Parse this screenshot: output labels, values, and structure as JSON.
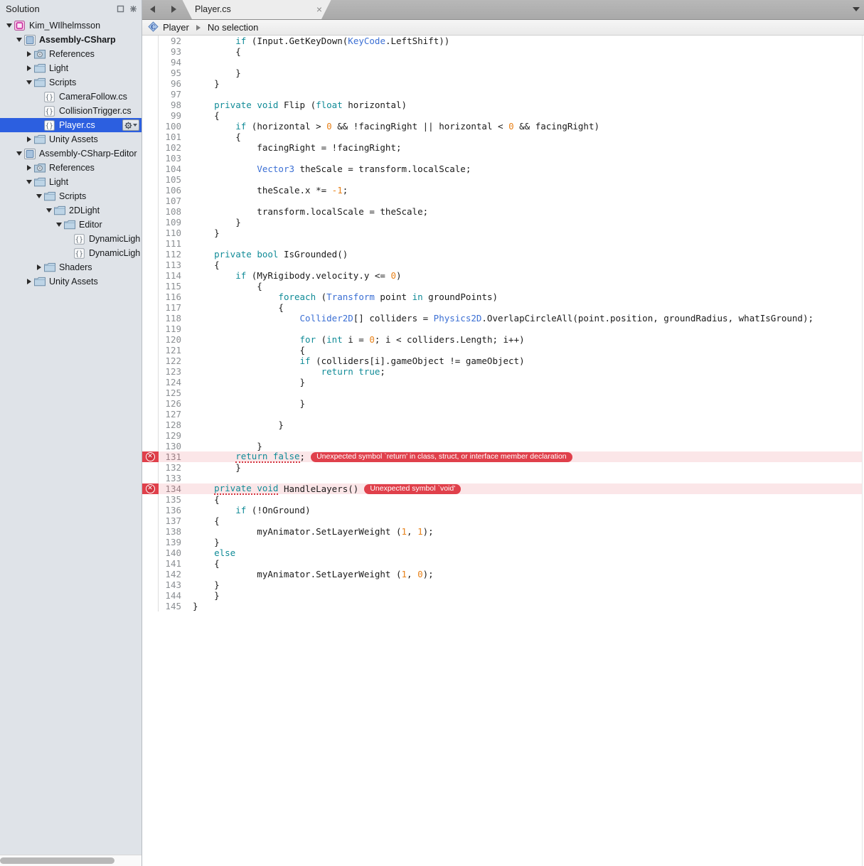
{
  "sidebar": {
    "title": "Solution",
    "window_buttons": [
      {
        "name": "maximize-icon",
        "glyph": "square"
      },
      {
        "name": "close-icon",
        "glyph": "cross"
      }
    ],
    "tree": [
      {
        "label": "Kim_WIlhelmsson",
        "indent": 0,
        "twisty": "open",
        "icon": "solution-icon",
        "bold": false,
        "selected": false
      },
      {
        "label": "Assembly-CSharp",
        "indent": 1,
        "twisty": "open",
        "icon": "project-icon",
        "bold": true,
        "selected": false
      },
      {
        "label": "References",
        "indent": 2,
        "twisty": "closed",
        "icon": "references-icon",
        "bold": false,
        "selected": false
      },
      {
        "label": "Light",
        "indent": 2,
        "twisty": "closed",
        "icon": "folder-icon",
        "bold": false,
        "selected": false
      },
      {
        "label": "Scripts",
        "indent": 2,
        "twisty": "open",
        "icon": "folder-icon",
        "bold": false,
        "selected": false
      },
      {
        "label": "CameraFollow.cs",
        "indent": 3,
        "twisty": "none",
        "icon": "csharp-file-icon",
        "bold": false,
        "selected": false
      },
      {
        "label": "CollisionTrigger.cs",
        "indent": 3,
        "twisty": "none",
        "icon": "csharp-file-icon",
        "bold": false,
        "selected": false
      },
      {
        "label": "Player.cs",
        "indent": 3,
        "twisty": "none",
        "icon": "csharp-file-icon",
        "bold": false,
        "selected": true
      },
      {
        "label": "Unity Assets",
        "indent": 2,
        "twisty": "closed",
        "icon": "folder-icon",
        "bold": false,
        "selected": false
      },
      {
        "label": "Assembly-CSharp-Editor",
        "indent": 1,
        "twisty": "open",
        "icon": "project-icon",
        "bold": false,
        "selected": false
      },
      {
        "label": "References",
        "indent": 2,
        "twisty": "closed",
        "icon": "references-icon",
        "bold": false,
        "selected": false
      },
      {
        "label": "Light",
        "indent": 2,
        "twisty": "open",
        "icon": "folder-icon",
        "bold": false,
        "selected": false
      },
      {
        "label": "Scripts",
        "indent": 3,
        "twisty": "open",
        "icon": "folder-icon",
        "bold": false,
        "selected": false
      },
      {
        "label": "2DLight",
        "indent": 4,
        "twisty": "open",
        "icon": "folder-icon",
        "bold": false,
        "selected": false
      },
      {
        "label": "Editor",
        "indent": 5,
        "twisty": "open",
        "icon": "folder-icon",
        "bold": false,
        "selected": false
      },
      {
        "label": "DynamicLightEditor.c",
        "indent": 6,
        "twisty": "none",
        "icon": "csharp-file-icon",
        "bold": false,
        "selected": false
      },
      {
        "label": "DynamicLightMenu.c",
        "indent": 6,
        "twisty": "none",
        "icon": "csharp-file-icon",
        "bold": false,
        "selected": false
      },
      {
        "label": "Shaders",
        "indent": 3,
        "twisty": "closed",
        "icon": "folder-icon",
        "bold": false,
        "selected": false
      },
      {
        "label": "Unity Assets",
        "indent": 2,
        "twisty": "closed",
        "icon": "folder-icon",
        "bold": false,
        "selected": false
      }
    ],
    "selected_row_gear": "gear-dropdown-button"
  },
  "tabstrip": {
    "back_label": "back-arrow",
    "forward_label": "forward-arrow",
    "tabs": [
      {
        "label": "Player.cs",
        "close": "×",
        "active": true
      }
    ],
    "overflow_menu": "tab-list-dropdown"
  },
  "breadcrumb": {
    "class_icon": "class-icon",
    "class_name": "Player",
    "member": "No selection"
  },
  "editor": {
    "first_line": 92,
    "error_icon_glyph": "✕",
    "lines": [
      {
        "n": 92,
        "error": false,
        "tokens": [
          {
            "t": "        ",
            "c": "pln"
          },
          {
            "t": "if",
            "c": "kw"
          },
          {
            "t": " (",
            "c": "pln"
          },
          {
            "t": "Input",
            "c": "pln"
          },
          {
            "t": ".GetKeyDown(",
            "c": "pln"
          },
          {
            "t": "KeyCode",
            "c": "typ"
          },
          {
            "t": ".LeftShift))",
            "c": "pln"
          }
        ]
      },
      {
        "n": 93,
        "error": false,
        "tokens": [
          {
            "t": "        {",
            "c": "pln"
          }
        ]
      },
      {
        "n": 94,
        "error": false,
        "tokens": []
      },
      {
        "n": 95,
        "error": false,
        "tokens": [
          {
            "t": "        }",
            "c": "pln"
          }
        ]
      },
      {
        "n": 96,
        "error": false,
        "tokens": [
          {
            "t": "    }",
            "c": "pln"
          }
        ]
      },
      {
        "n": 97,
        "error": false,
        "tokens": []
      },
      {
        "n": 98,
        "error": false,
        "tokens": [
          {
            "t": "    ",
            "c": "pln"
          },
          {
            "t": "private void",
            "c": "kw"
          },
          {
            "t": " Flip (",
            "c": "pln"
          },
          {
            "t": "float",
            "c": "kw"
          },
          {
            "t": " horizontal)",
            "c": "pln"
          }
        ]
      },
      {
        "n": 99,
        "error": false,
        "tokens": [
          {
            "t": "    {",
            "c": "pln"
          }
        ]
      },
      {
        "n": 100,
        "error": false,
        "tokens": [
          {
            "t": "        ",
            "c": "pln"
          },
          {
            "t": "if",
            "c": "kw"
          },
          {
            "t": " (horizontal > ",
            "c": "pln"
          },
          {
            "t": "0",
            "c": "num"
          },
          {
            "t": " && !facingRight || horizontal < ",
            "c": "pln"
          },
          {
            "t": "0",
            "c": "num"
          },
          {
            "t": " && facingRight)",
            "c": "pln"
          }
        ]
      },
      {
        "n": 101,
        "error": false,
        "tokens": [
          {
            "t": "        {",
            "c": "pln"
          }
        ]
      },
      {
        "n": 102,
        "error": false,
        "tokens": [
          {
            "t": "            facingRight = !facingRight;",
            "c": "pln"
          }
        ]
      },
      {
        "n": 103,
        "error": false,
        "tokens": []
      },
      {
        "n": 104,
        "error": false,
        "tokens": [
          {
            "t": "            ",
            "c": "pln"
          },
          {
            "t": "Vector3",
            "c": "typ"
          },
          {
            "t": " theScale = transform.localScale;",
            "c": "pln"
          }
        ]
      },
      {
        "n": 105,
        "error": false,
        "tokens": []
      },
      {
        "n": 106,
        "error": false,
        "tokens": [
          {
            "t": "            theScale.x *= ",
            "c": "pln"
          },
          {
            "t": "-1",
            "c": "num"
          },
          {
            "t": ";",
            "c": "pln"
          }
        ]
      },
      {
        "n": 107,
        "error": false,
        "tokens": []
      },
      {
        "n": 108,
        "error": false,
        "tokens": [
          {
            "t": "            transform.localScale = theScale;",
            "c": "pln"
          }
        ]
      },
      {
        "n": 109,
        "error": false,
        "tokens": [
          {
            "t": "        }",
            "c": "pln"
          }
        ]
      },
      {
        "n": 110,
        "error": false,
        "tokens": [
          {
            "t": "    }",
            "c": "pln"
          }
        ]
      },
      {
        "n": 111,
        "error": false,
        "tokens": []
      },
      {
        "n": 112,
        "error": false,
        "tokens": [
          {
            "t": "    ",
            "c": "pln"
          },
          {
            "t": "private bool",
            "c": "kw"
          },
          {
            "t": " IsGrounded()",
            "c": "pln"
          }
        ]
      },
      {
        "n": 113,
        "error": false,
        "tokens": [
          {
            "t": "    {",
            "c": "pln"
          }
        ]
      },
      {
        "n": 114,
        "error": false,
        "tokens": [
          {
            "t": "        ",
            "c": "pln"
          },
          {
            "t": "if",
            "c": "kw"
          },
          {
            "t": " (MyRigibody.velocity.y <= ",
            "c": "pln"
          },
          {
            "t": "0",
            "c": "num"
          },
          {
            "t": ")",
            "c": "pln"
          }
        ]
      },
      {
        "n": 115,
        "error": false,
        "tokens": [
          {
            "t": "            {",
            "c": "pln"
          }
        ]
      },
      {
        "n": 116,
        "error": false,
        "tokens": [
          {
            "t": "                ",
            "c": "pln"
          },
          {
            "t": "foreach",
            "c": "kw"
          },
          {
            "t": " (",
            "c": "pln"
          },
          {
            "t": "Transform",
            "c": "typ"
          },
          {
            "t": " point ",
            "c": "pln"
          },
          {
            "t": "in",
            "c": "kw"
          },
          {
            "t": " groundPoints)",
            "c": "pln"
          }
        ]
      },
      {
        "n": 117,
        "error": false,
        "tokens": [
          {
            "t": "                {",
            "c": "pln"
          }
        ]
      },
      {
        "n": 118,
        "error": false,
        "tokens": [
          {
            "t": "                    ",
            "c": "pln"
          },
          {
            "t": "Collider2D",
            "c": "typ"
          },
          {
            "t": "[] colliders = ",
            "c": "pln"
          },
          {
            "t": "Physics2D",
            "c": "typ"
          },
          {
            "t": ".OverlapCircleAll(point.position, groundRadius, whatIsGround);",
            "c": "pln"
          }
        ]
      },
      {
        "n": 119,
        "error": false,
        "tokens": []
      },
      {
        "n": 120,
        "error": false,
        "tokens": [
          {
            "t": "                    ",
            "c": "pln"
          },
          {
            "t": "for",
            "c": "kw"
          },
          {
            "t": " (",
            "c": "pln"
          },
          {
            "t": "int",
            "c": "kw"
          },
          {
            "t": " i = ",
            "c": "pln"
          },
          {
            "t": "0",
            "c": "num"
          },
          {
            "t": "; i < colliders.Length; i++)",
            "c": "pln"
          }
        ]
      },
      {
        "n": 121,
        "error": false,
        "tokens": [
          {
            "t": "                    {",
            "c": "pln"
          }
        ]
      },
      {
        "n": 122,
        "error": false,
        "tokens": [
          {
            "t": "                    ",
            "c": "pln"
          },
          {
            "t": "if",
            "c": "kw"
          },
          {
            "t": " (colliders[i].gameObject != gameObject)",
            "c": "pln"
          }
        ]
      },
      {
        "n": 123,
        "error": false,
        "tokens": [
          {
            "t": "                        ",
            "c": "pln"
          },
          {
            "t": "return true",
            "c": "kw"
          },
          {
            "t": ";",
            "c": "pln"
          }
        ]
      },
      {
        "n": 124,
        "error": false,
        "tokens": [
          {
            "t": "                    }",
            "c": "pln"
          }
        ]
      },
      {
        "n": 125,
        "error": false,
        "tokens": []
      },
      {
        "n": 126,
        "error": false,
        "tokens": [
          {
            "t": "                    }",
            "c": "pln"
          }
        ]
      },
      {
        "n": 127,
        "error": false,
        "tokens": []
      },
      {
        "n": 128,
        "error": false,
        "tokens": [
          {
            "t": "                }",
            "c": "pln"
          }
        ]
      },
      {
        "n": 129,
        "error": false,
        "tokens": []
      },
      {
        "n": 130,
        "error": false,
        "tokens": [
          {
            "t": "            }",
            "c": "pln"
          }
        ]
      },
      {
        "n": 131,
        "error": true,
        "tokens": [
          {
            "t": "        ",
            "c": "pln"
          },
          {
            "t": "return false",
            "c": "kw squig"
          },
          {
            "t": ";",
            "c": "pln"
          }
        ],
        "badge": "Unexpected symbol `return' in class, struct, or interface member declaration"
      },
      {
        "n": 132,
        "error": false,
        "tokens": [
          {
            "t": "        }",
            "c": "pln"
          }
        ]
      },
      {
        "n": 133,
        "error": false,
        "tokens": []
      },
      {
        "n": 134,
        "error": true,
        "tokens": [
          {
            "t": "    ",
            "c": "pln"
          },
          {
            "t": "private void",
            "c": "kw squig"
          },
          {
            "t": " HandleLayers()",
            "c": "pln"
          }
        ],
        "badge": "Unexpected symbol `void'"
      },
      {
        "n": 135,
        "error": false,
        "tokens": [
          {
            "t": "    {",
            "c": "pln"
          }
        ]
      },
      {
        "n": 136,
        "error": false,
        "tokens": [
          {
            "t": "        ",
            "c": "pln"
          },
          {
            "t": "if",
            "c": "kw"
          },
          {
            "t": " (!OnGround)",
            "c": "pln"
          }
        ]
      },
      {
        "n": 137,
        "error": false,
        "tokens": [
          {
            "t": "    {",
            "c": "pln"
          }
        ]
      },
      {
        "n": 138,
        "error": false,
        "tokens": [
          {
            "t": "            myAnimator.SetLayerWeight (",
            "c": "pln"
          },
          {
            "t": "1",
            "c": "num"
          },
          {
            "t": ", ",
            "c": "pln"
          },
          {
            "t": "1",
            "c": "num"
          },
          {
            "t": ");",
            "c": "pln"
          }
        ]
      },
      {
        "n": 139,
        "error": false,
        "tokens": [
          {
            "t": "    }",
            "c": "pln"
          }
        ]
      },
      {
        "n": 140,
        "error": false,
        "tokens": [
          {
            "t": "    ",
            "c": "pln"
          },
          {
            "t": "else",
            "c": "kw"
          }
        ]
      },
      {
        "n": 141,
        "error": false,
        "tokens": [
          {
            "t": "    {",
            "c": "pln"
          }
        ]
      },
      {
        "n": 142,
        "error": false,
        "tokens": [
          {
            "t": "            myAnimator.SetLayerWeight (",
            "c": "pln"
          },
          {
            "t": "1",
            "c": "num"
          },
          {
            "t": ", ",
            "c": "pln"
          },
          {
            "t": "0",
            "c": "num"
          },
          {
            "t": ");",
            "c": "pln"
          }
        ]
      },
      {
        "n": 143,
        "error": false,
        "tokens": [
          {
            "t": "    }",
            "c": "pln"
          }
        ]
      },
      {
        "n": 144,
        "error": false,
        "tokens": [
          {
            "t": "    }",
            "c": "pln"
          }
        ]
      },
      {
        "n": 145,
        "error": false,
        "tokens": [
          {
            "t": "}",
            "c": "pln"
          }
        ]
      }
    ]
  },
  "colors": {
    "selection_blue": "#2c5fe0",
    "error_red": "#e0404b",
    "error_line_bg": "#fbe6e8",
    "keyword_teal": "#108b97",
    "type_blue": "#3b6fd4",
    "number_orange": "#e8821a",
    "sidebar_bg": "#dfe3e8"
  }
}
